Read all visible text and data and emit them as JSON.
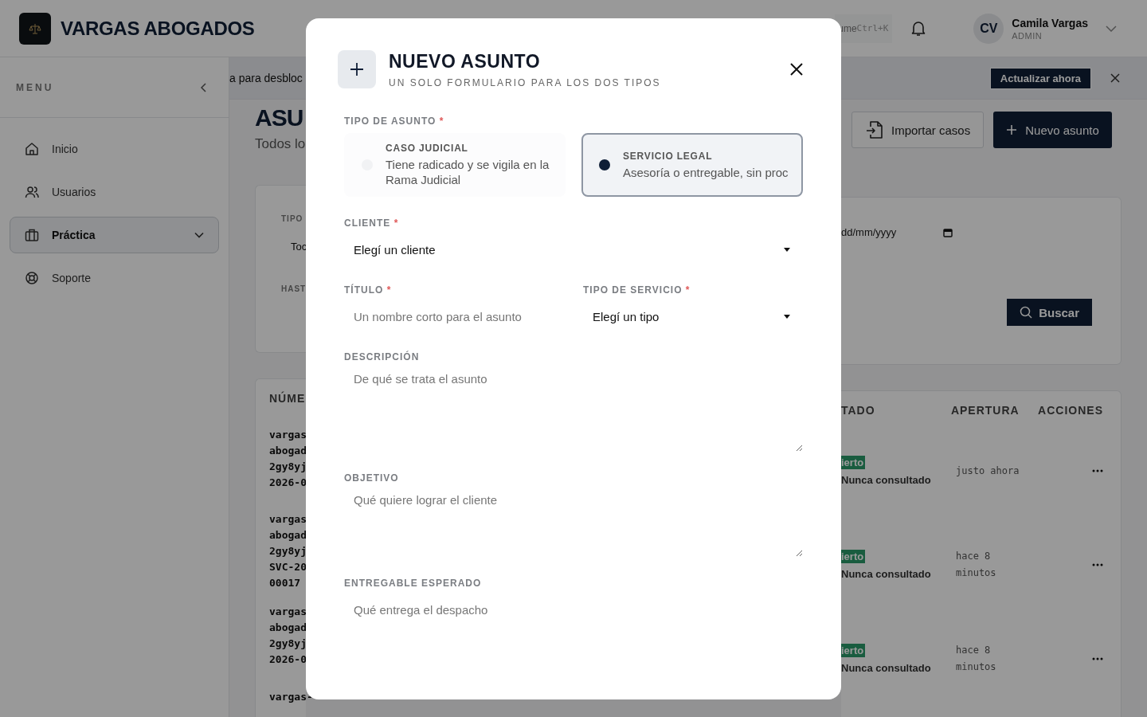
{
  "header": {
    "brand": "VARGAS ABOGADOS",
    "search_fragment": "ume",
    "shortcut": "Ctrl+K",
    "user": {
      "initials": "CV",
      "name": "Camila Vargas",
      "role": "ADMIN"
    }
  },
  "sidebar": {
    "title": "MENU",
    "items": [
      {
        "label": "Inicio",
        "selected": false,
        "expandable": false
      },
      {
        "label": "Usuarios",
        "selected": false,
        "expandable": false
      },
      {
        "label": "Práctica",
        "selected": true,
        "expandable": true
      },
      {
        "label": "Soporte",
        "selected": false,
        "expandable": false
      }
    ]
  },
  "banner": {
    "text": "a para desbloc",
    "action": "Actualizar ahora"
  },
  "page": {
    "title": "ASU",
    "subtitle": "Todos lo",
    "buttons": [
      {
        "label": "Importar casos",
        "kind": "secondary"
      },
      {
        "label": "Nuevo asunto",
        "kind": "primary"
      }
    ]
  },
  "filters": {
    "type_label": "TIPO",
    "type_value": "Toc",
    "until_label": "HAST",
    "date_placeholder": "dd/mm/yyyy",
    "search_button": "Buscar"
  },
  "table": {
    "columns": [
      "NÚME",
      "TADO",
      "APERTURA",
      "ACCIONES"
    ],
    "rows": [
      {
        "number_lines": [
          "vargas",
          "abogad",
          "2gy8yj",
          "2026-0"
        ],
        "status": "ierto",
        "consulted": "Nunca consultado",
        "opened": "justo ahora"
      },
      {
        "number_lines": [
          "vargas",
          "abogad",
          "2gy8yj",
          "SVC-20",
          "00017"
        ],
        "status": "ierto",
        "consulted": "Nunca consultado",
        "opened": "hace 8 minutos"
      },
      {
        "number_lines": [
          "vargas",
          "abogad",
          "2gy8yj",
          "2026-0"
        ],
        "status": "ierto",
        "consulted": "Nunca consultado",
        "opened": "hace 8 minutos"
      },
      {
        "number_lines": [
          "vargas-"
        ]
      }
    ]
  },
  "modal": {
    "title": "NUEVO ASUNTO",
    "subtitle": "UN SOLO FORMULARIO PARA LOS DOS TIPOS",
    "rows": [
      [
        {
          "kind": "radio",
          "label": "TIPO DE ASUNTO",
          "required_mark": "*",
          "options": [
            {
              "label": "CASO JUDICIAL",
              "description": "Tiene radicado y se vigila en la Rama Judicial",
              "selected": false
            },
            {
              "label": "SERVICIO LEGAL",
              "description": "Asesoría o entregable, sin proc",
              "selected": true
            }
          ]
        }
      ],
      [
        {
          "kind": "select",
          "label": "CLIENTE",
          "required_mark": "*",
          "value": "Elegí un cliente"
        }
      ],
      [
        {
          "kind": "input",
          "label": "TÍTULO",
          "required_mark": "*",
          "placeholder": "Un nombre corto para el asunto"
        },
        {
          "kind": "select",
          "label": "TIPO DE SERVICIO",
          "required_mark": "*",
          "value": "Elegí un tipo"
        }
      ],
      [
        {
          "kind": "textarea",
          "label": "DESCRIPCIÓN",
          "placeholder": "De qué se trata el asunto"
        }
      ],
      [
        {
          "kind": "textarea",
          "label": "OBJETIVO",
          "placeholder": "Qué quiere lograr el cliente"
        }
      ],
      [
        {
          "kind": "input",
          "label": "ENTREGABLE ESPERADO",
          "placeholder": "Qué entrega el despacho"
        }
      ]
    ]
  }
}
